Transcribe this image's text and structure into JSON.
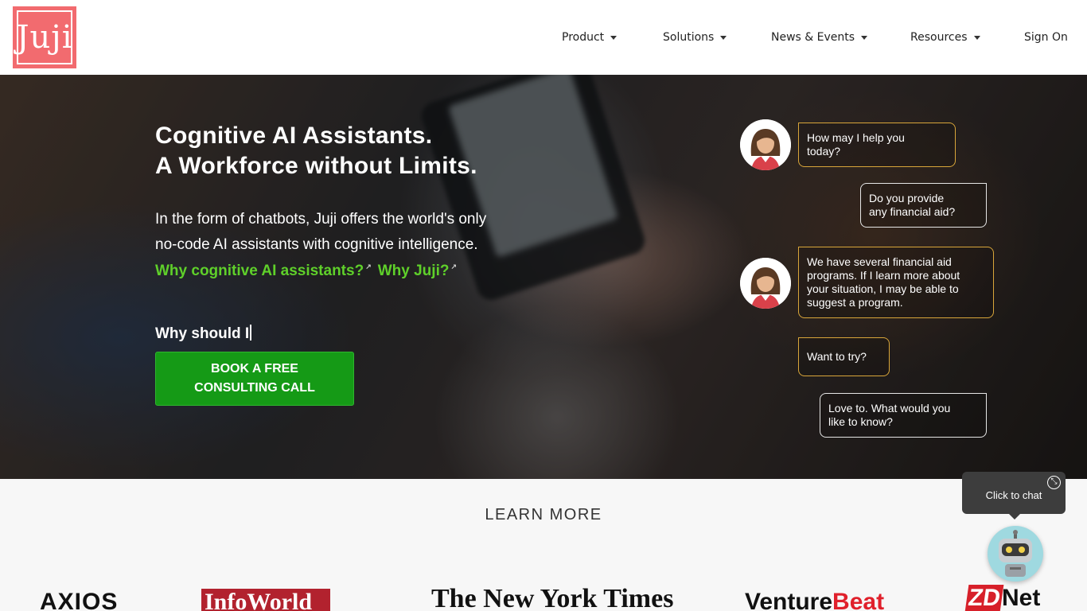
{
  "header": {
    "logo_text": "Juji",
    "nav": [
      {
        "label": "Product",
        "has_dropdown": true
      },
      {
        "label": "Solutions",
        "has_dropdown": true
      },
      {
        "label": "News & Events",
        "has_dropdown": true
      },
      {
        "label": "Resources",
        "has_dropdown": true
      },
      {
        "label": "Sign On",
        "has_dropdown": false
      }
    ]
  },
  "hero": {
    "title_line1": "Cognitive AI Assistants.",
    "title_line2": "A Workforce without Limits.",
    "lead_line1": "In the form of chatbots, Juji offers the world's only",
    "lead_line2": "no-code AI assistants with cognitive intelligence.",
    "link1": "Why cognitive AI assistants?",
    "link2": "Why Juji?",
    "typing_text": "Why should I",
    "cta_line1": "BOOK A FREE",
    "cta_line2": "CONSULTING CALL",
    "link_color": "#5fd02a",
    "cta_color": "#159a16"
  },
  "chat": {
    "bubble1_line1": "How may I help you",
    "bubble1_line2": "today?",
    "bubble2_line1": "Do you provide",
    "bubble2_line2": "any financial aid?",
    "bubble3_line1": "We have several financial aid",
    "bubble3_line2": "programs. If I learn more about",
    "bubble3_line3": "your situation, I may be able to",
    "bubble3_line4": "suggest a program.",
    "bubble4": "Want to try?",
    "bubble5_line1": "Love to. What would you",
    "bubble5_line2": "like to know?",
    "bot_border_color": "#d9a63a"
  },
  "learn_more": {
    "heading": "LEARN MORE",
    "press": {
      "axios": "AXIOS",
      "infoworld": "InfoWorld",
      "nyt": "The New York Times",
      "venturebeat_a": "Venture",
      "venturebeat_b": "Beat",
      "zdnet_a": "ZD",
      "zdnet_b": "Net"
    }
  },
  "widget": {
    "tooltip": "Click to chat",
    "close_icon": "collapse-icon",
    "bot_icon": "robot-icon"
  }
}
